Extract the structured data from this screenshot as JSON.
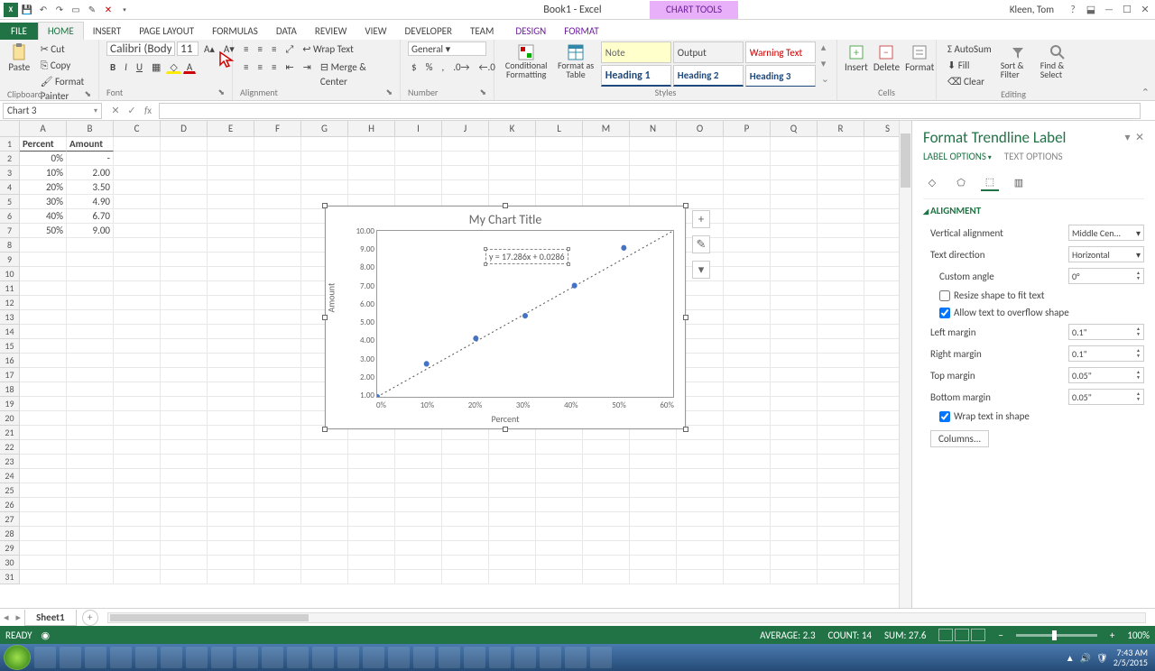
{
  "window": {
    "title": "Book1 - Excel",
    "chart_tools": "CHART TOOLS",
    "user": "Kleen, Tom"
  },
  "tabs": {
    "file": "FILE",
    "home": "HOME",
    "insert": "INSERT",
    "pagelayout": "PAGE LAYOUT",
    "formulas": "FORMULAS",
    "data": "DATA",
    "review": "REVIEW",
    "view": "VIEW",
    "developer": "DEVELOPER",
    "team": "TEAM",
    "design": "DESIGN",
    "format": "FORMAT"
  },
  "ribbon": {
    "clipboard": {
      "paste": "Paste",
      "cut": "Cut",
      "copy": "Copy",
      "painter": "Format Painter",
      "label": "Clipboard"
    },
    "font": {
      "name": "Calibri (Body)",
      "size": "11",
      "label": "Font"
    },
    "alignment": {
      "wrap": "Wrap Text",
      "merge": "Merge & Center",
      "label": "Alignment"
    },
    "number": {
      "format": "General",
      "label": "Number"
    },
    "styles": {
      "cond": "Conditional Formatting",
      "fat": "Format as Table",
      "note": "Note",
      "output": "Output",
      "warn": "Warning Text",
      "h1": "Heading 1",
      "h2": "Heading 2",
      "h3": "Heading 3",
      "label": "Styles"
    },
    "cells": {
      "insert": "Insert",
      "delete": "Delete",
      "format": "Format",
      "label": "Cells"
    },
    "editing": {
      "autosum": "AutoSum",
      "fill": "Fill",
      "clear": "Clear",
      "sort": "Sort & Filter",
      "find": "Find & Select",
      "label": "Editing"
    }
  },
  "namebox": "Chart 3",
  "columns": [
    "A",
    "B",
    "C",
    "D",
    "E",
    "F",
    "G",
    "H",
    "I",
    "J",
    "K",
    "L",
    "M",
    "N",
    "O",
    "P",
    "Q",
    "R",
    "S"
  ],
  "row_headers": [
    "1",
    "2",
    "3",
    "4",
    "5",
    "6",
    "7",
    "8",
    "9",
    "10",
    "11",
    "12",
    "13",
    "14",
    "15",
    "16",
    "17",
    "18",
    "19",
    "20",
    "21",
    "22",
    "23",
    "24",
    "25",
    "26",
    "27",
    "28",
    "29",
    "30",
    "31"
  ],
  "cells": {
    "A1": "Percent",
    "B1": "Amount",
    "A2": "0%",
    "B2": "-",
    "A3": "10%",
    "B3": "2.00",
    "A4": "20%",
    "B4": "3.50",
    "A5": "30%",
    "B5": "4.90",
    "A6": "40%",
    "B6": "6.70",
    "A7": "50%",
    "B7": "9.00"
  },
  "chart": {
    "title": "My Chart Title",
    "xlabel": "Percent",
    "ylabel": "Amount",
    "trend_eqn": "y = 17.286x + 0.0286",
    "xticks": [
      "0%",
      "10%",
      "20%",
      "30%",
      "40%",
      "50%",
      "60%"
    ],
    "yticks": [
      "1.00",
      "2.00",
      "3.00",
      "4.00",
      "5.00",
      "6.00",
      "7.00",
      "8.00",
      "9.00",
      "10.00"
    ]
  },
  "chart_data": {
    "type": "scatter",
    "x": [
      0,
      10,
      20,
      30,
      40,
      50
    ],
    "y": [
      0,
      2.0,
      3.5,
      4.9,
      6.7,
      9.0
    ],
    "trendline": {
      "slope": 17.286,
      "intercept": 0.0286,
      "text": "y = 17.286x + 0.0286"
    },
    "title": "My Chart Title",
    "xlabel": "Percent",
    "ylabel": "Amount",
    "xlim": [
      0,
      60
    ],
    "ylim": [
      0,
      10
    ]
  },
  "taskpane": {
    "title": "Format Trendline Label",
    "subtabs": {
      "label": "LABEL OPTIONS",
      "text": "TEXT OPTIONS"
    },
    "section": "ALIGNMENT",
    "valign_lbl": "Vertical alignment",
    "valign": "Middle Cen...",
    "tdir_lbl": "Text direction",
    "tdir": "Horizontal",
    "angle_lbl": "Custom angle",
    "angle": "0°",
    "resize": "Resize shape to fit text",
    "overflow": "Allow text to overflow shape",
    "lm_lbl": "Left margin",
    "lm": "0.1\"",
    "rm_lbl": "Right margin",
    "rm": "0.1\"",
    "tm_lbl": "Top margin",
    "tm": "0.05\"",
    "bm_lbl": "Bottom margin",
    "bm": "0.05\"",
    "wrap": "Wrap text in shape",
    "columns": "Columns..."
  },
  "sheet_tabs": {
    "sheet1": "Sheet1"
  },
  "statusbar": {
    "ready": "READY",
    "avg": "AVERAGE: 2.3",
    "count": "COUNT: 14",
    "sum": "SUM: 27.6",
    "zoom": "100%"
  },
  "clock": {
    "time": "7:43 AM",
    "date": "2/5/2015"
  }
}
